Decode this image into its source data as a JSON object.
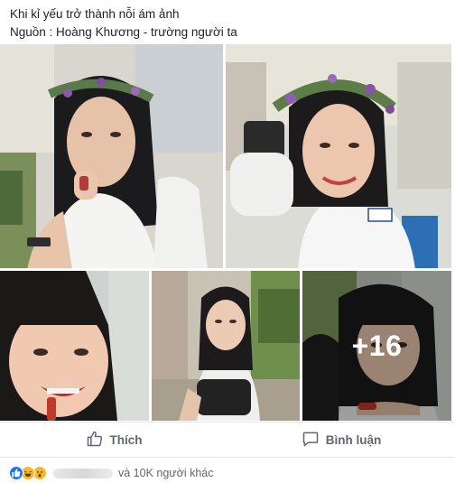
{
  "post": {
    "line1": "Khi kỉ yếu trở thành nỗi ám ảnh",
    "line2": "Nguồn : Hoàng Khương - trường người ta"
  },
  "photos": {
    "more_label": "+16"
  },
  "actions": {
    "like_label": "Thích",
    "comment_label": "Bình luận"
  },
  "reactions": {
    "icons": [
      "like-icon",
      "haha-icon",
      "wow-icon"
    ],
    "others_text": "và 10K người khác"
  },
  "colors": {
    "like_blue": "#1877f2",
    "emoji_yellow": "#f7b928",
    "action_gray": "#606770"
  }
}
